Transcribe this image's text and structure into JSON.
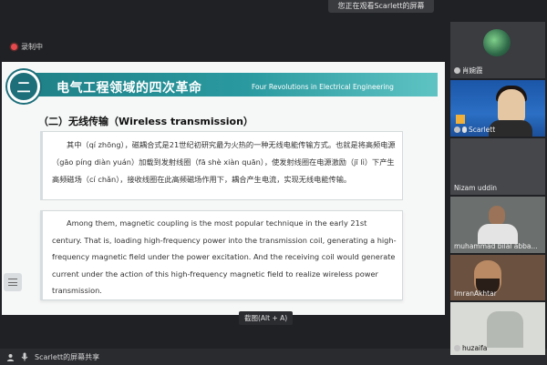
{
  "top_banner": "您正在观看Scarlett的屏幕",
  "recording_label": "录制中",
  "slide": {
    "badge": "二",
    "title": "电气工程领域的四次革命",
    "title_en": "Four Revolutions in Electrical Engineering",
    "section_heading": "（二）无线传输（Wireless transmission）",
    "paragraph_cn": "其中（qí zhōng），磁耦合式是21世纪初研究最为火热的一种无线电能传输方式。也就是将高频电源（gāo píng diàn yuán）加载到发射线圈（fā shè xiàn quān），使发射线圈在电源激励（jī lì）下产生高频磁场（cí chǎn），接收线圈在此高频磁场作用下，耦合产生电流，实现无线电能传输。",
    "paragraph_en": "Among them, magnetic coupling is the most popular technique in the early 21st century. That is, loading high-frequency power into the transmission coil, generating a high-frequency magnetic field under the power excitation. And the receiving coil would generate current under the action of this high-frequency magnetic field to realize wireless power transmission."
  },
  "shortcut_tip": "截图(Alt + A)",
  "share_label": "Scarlett的屏幕共享",
  "participants": [
    {
      "name": "肖婉霞"
    },
    {
      "name": "Scarlett"
    },
    {
      "name": "Nizam uddin"
    },
    {
      "name": "muhammad bilal abba..."
    },
    {
      "name": "ImranAkhtar"
    },
    {
      "name": "huzaifa"
    }
  ],
  "colors": {
    "header_teal": "#1f7f86",
    "recording_red": "#e5484d"
  }
}
